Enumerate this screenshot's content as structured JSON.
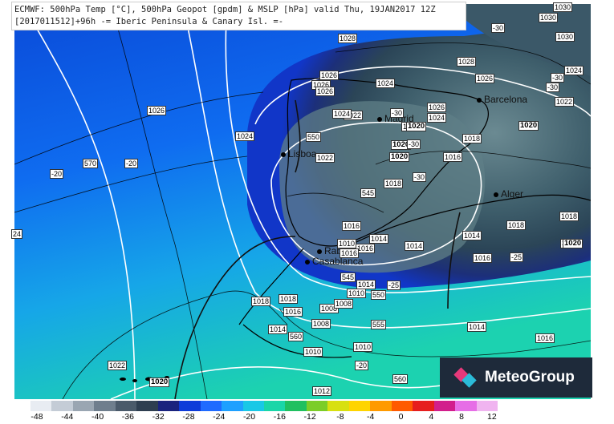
{
  "header": {
    "line1": "ECMWF: 500hPa Temp [°C], 500hPa Geopot [gpdm] & MSLP [hPa] valid Thu, 19JAN2017 12Z",
    "line2": "[2017011512]+96h -= Iberic Peninsula & Canary Isl. =-"
  },
  "logo": {
    "text": "MeteoGroup"
  },
  "cities": [
    "Barcelona",
    "Madrid",
    "Lisboa",
    "Alger",
    "Rabat",
    "Casablanca"
  ],
  "labels": [
    "1030",
    "1030",
    "1030",
    "1024",
    "1024",
    "1022",
    "-30",
    "-30",
    "-30",
    "1026",
    "1028",
    "1028",
    "1026",
    "1026",
    "1026",
    "1024",
    "1022",
    "1024",
    "1022",
    "-30",
    "1026",
    "1024",
    "1020",
    "1020",
    "1020",
    "1020",
    "1020",
    "1018",
    "1016",
    "-30",
    "550",
    "1024",
    "1026",
    "-20",
    "570",
    "-20",
    "24",
    "545",
    "1018",
    "-30",
    "1016",
    "1014",
    "1016",
    "1014",
    "1010",
    "1016",
    "1016",
    "1014",
    "1018",
    "1018",
    "-25",
    "1020",
    "545",
    "1014",
    "1010",
    "550",
    "-25",
    "1018",
    "1018",
    "1016",
    "1008",
    "1008",
    "1008",
    "1014",
    "555",
    "1014",
    "1016",
    "560",
    "1010",
    "1010",
    "1022",
    "1020",
    "-20",
    "560",
    "1012"
  ],
  "scale": {
    "ticks": [
      "-48",
      "-44",
      "-40",
      "-36",
      "-32",
      "-28",
      "-24",
      "-20",
      "-16",
      "-12",
      "-8",
      "-4",
      "0",
      "4",
      "8",
      "12"
    ],
    "colors": [
      "#e8ecf2",
      "#c4ccd6",
      "#9aa6b2",
      "#6f7e8d",
      "#4a5a6a",
      "#2e3e50",
      "#1a237e",
      "#0d3bd9",
      "#1f6bff",
      "#1ea0ff",
      "#19c8e6",
      "#1ad6a8",
      "#20c060",
      "#7ccd28",
      "#d8e010",
      "#ffd400",
      "#ff9a00",
      "#ff5a00",
      "#e61e1e",
      "#d21e8c",
      "#e66ee6",
      "#f0b4f0"
    ]
  }
}
